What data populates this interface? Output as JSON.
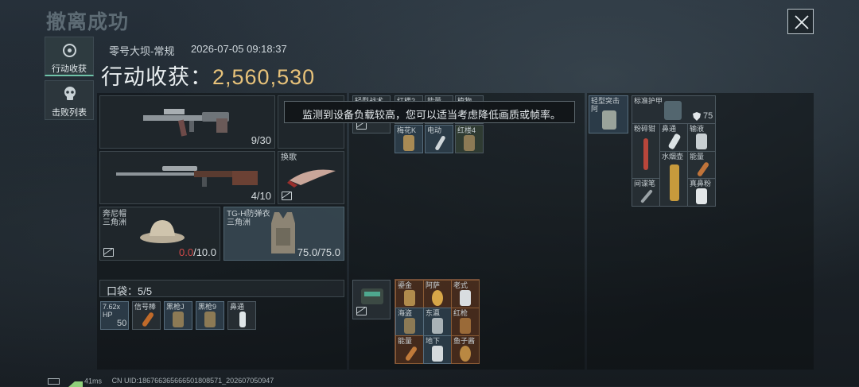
{
  "header": {
    "title": "撤离成功",
    "close_label": "×"
  },
  "tabs": [
    {
      "label": "行动收获",
      "icon": "target-icon"
    },
    {
      "label": "击败列表",
      "icon": "skull-icon"
    }
  ],
  "meta": {
    "map": "零号大坝-常规",
    "datetime": "2026-07-05 09:18:37"
  },
  "harvest": {
    "label": "行动收获：",
    "value": "2,560,530"
  },
  "loadout": {
    "primary_weapon": {
      "ammo": "9/30"
    },
    "secondary_weapon": {
      "ammo": "4/10"
    },
    "melee": {
      "name": "换歌"
    },
    "helmet": {
      "name": "奔尼帽",
      "sub": "三角洲",
      "dur_current": "0.0",
      "dur_max": "/10.0"
    },
    "armor": {
      "name": "TG-H防弹衣",
      "sub": "三角洲",
      "durability": "75.0/75.0"
    },
    "pocket": {
      "label": "口袋：",
      "count": "5/5"
    },
    "pocket_items": [
      {
        "label": "7.62x",
        "label2": "HP",
        "count": "50"
      },
      {
        "label": "信号棒"
      },
      {
        "label": "黑枪J"
      },
      {
        "label": "黑枪9"
      },
      {
        "label": "鼻通"
      }
    ]
  },
  "tooltip": "监测到设备负载较高，您可以适当考虑降低画质或帧率。",
  "chest_rig": {
    "label": "轻型战术",
    "items": [
      {
        "label": "红楼2"
      },
      {
        "label": "能量"
      },
      {
        "label": "植物"
      },
      {
        "label": "梅花K"
      },
      {
        "label": "电动"
      },
      {
        "label": "红楼4"
      }
    ]
  },
  "backpack_items": [
    {
      "label": "鎏金"
    },
    {
      "label": "阿萨"
    },
    {
      "label": "老式"
    },
    {
      "label": "海盗"
    },
    {
      "label": "东瀛"
    },
    {
      "label": "红枪"
    },
    {
      "label": "能量"
    },
    {
      "label": "地下"
    },
    {
      "label": "鱼子酱"
    }
  ],
  "right_panel": {
    "vest_label": "轻型突击",
    "vest_sub": "阿",
    "armor_label": "标准护甲",
    "armor_value": "75",
    "items": [
      {
        "label": "粉碎钳"
      },
      {
        "label": "鼻通"
      },
      {
        "label": "输液"
      },
      {
        "label": "水烟壶"
      },
      {
        "label": "能量"
      },
      {
        "label": "间谍笔"
      },
      {
        "label": "真鼻粉"
      }
    ]
  },
  "status": {
    "ping": "41ms",
    "uid": "CN UID:18676636566650180857​1_202607050947"
  }
}
